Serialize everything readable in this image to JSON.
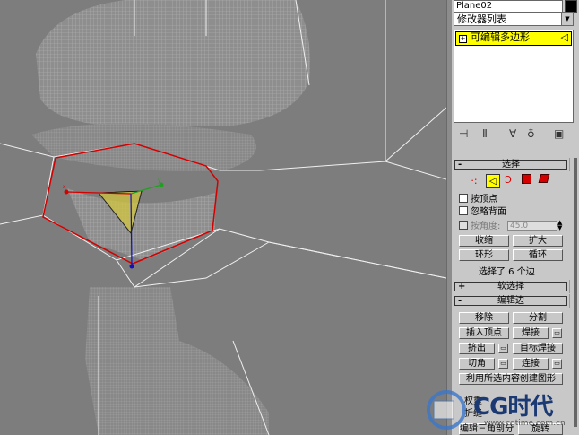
{
  "object": {
    "name": "Plane02",
    "color": "#000000"
  },
  "modifier_list": {
    "label": "修改器列表"
  },
  "stack": {
    "item_label": "可编辑多边形"
  },
  "toolbar": {
    "icons": [
      "pin-stack-icon",
      "show-end-result-icon",
      "make-unique-icon",
      "remove-modifier-icon",
      "configure-modifier-sets-icon"
    ]
  },
  "selection": {
    "header": "选择",
    "by_vertex": "按顶点",
    "ignore_backfacing": "忽略背面",
    "by_angle": "按角度:",
    "angle_value": "45.0",
    "shrink": "收缩",
    "grow": "扩大",
    "ring": "环形",
    "loop": "循环",
    "status": "选择了 6 个边"
  },
  "soft_selection": {
    "header": "软选择"
  },
  "edit_edges": {
    "header": "编辑边",
    "remove": "移除",
    "split": "分割",
    "insert_vertex": "插入顶点",
    "weld": "焊接",
    "extrude": "挤出",
    "target_weld": "目标焊接",
    "chamfer": "切角",
    "connect": "连接",
    "create_shape": "利用所选内容创建图形",
    "weight_partial": "权重",
    "crease_partial": "折缝",
    "edit_tri": "编辑三角剖分",
    "turn": "旋转"
  },
  "watermark": {
    "text": "CG时代",
    "url": "www.cgtime.com.cn"
  },
  "colors": {
    "accent_yellow": "#ffff00",
    "selected_edge": "#d40000",
    "panel_bg": "#c8c8c8"
  }
}
